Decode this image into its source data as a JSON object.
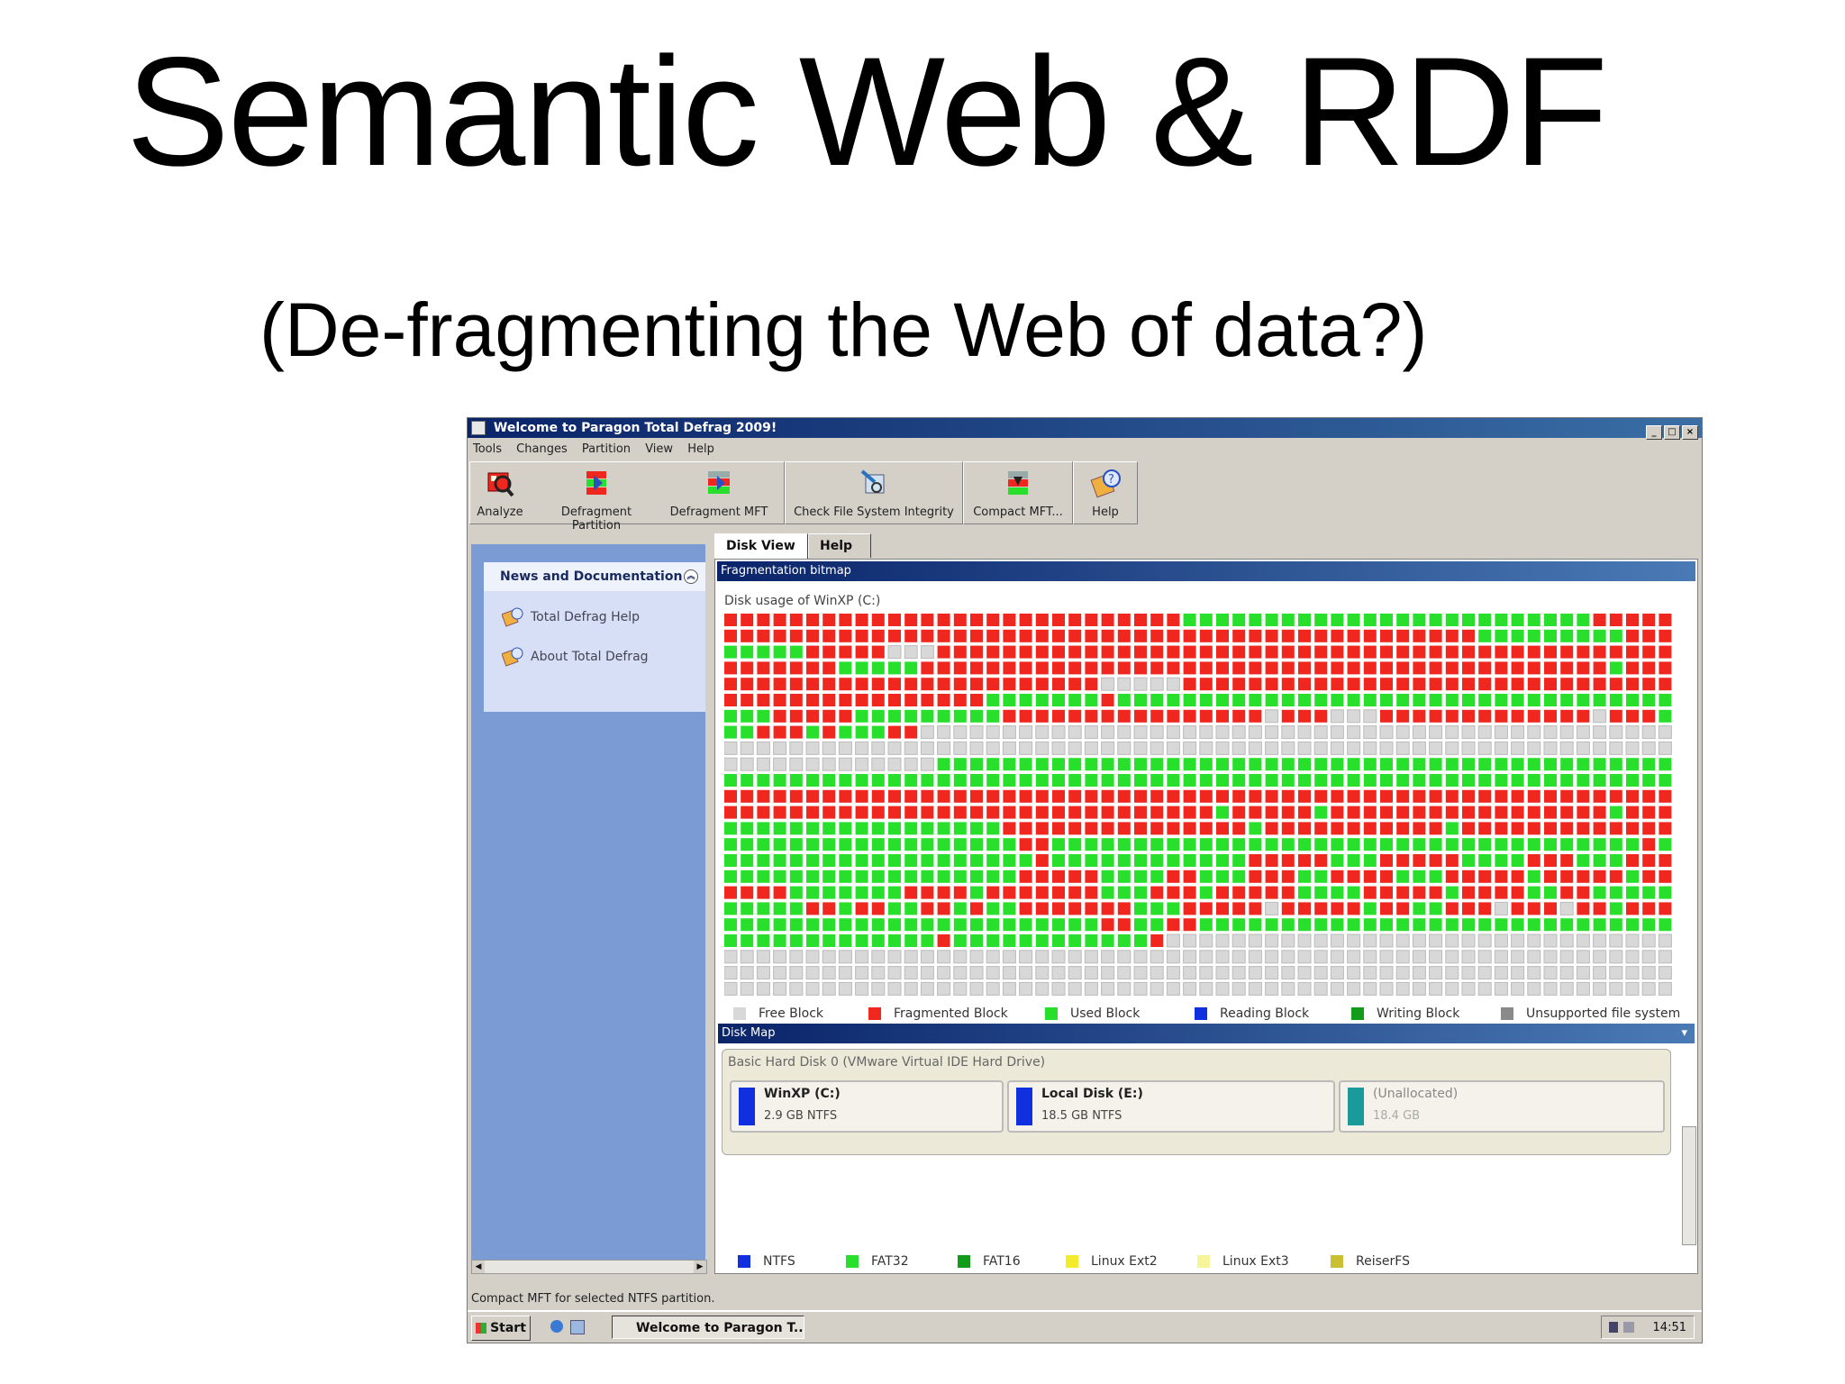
{
  "slide": {
    "title": "Semantic Web & RDF",
    "subtitle": "(De-fragmenting the Web of data?)"
  },
  "window": {
    "title": "Welcome to Paragon Total Defrag 2009!",
    "menu": [
      "Tools",
      "Changes",
      "Partition",
      "View",
      "Help"
    ],
    "toolbar": {
      "analyze": "Analyze",
      "defrag_partition": "Defragment Partition",
      "defrag_mft": "Defragment MFT",
      "check_fs": "Check File System Integrity",
      "compact_mft": "Compact MFT...",
      "help": "Help"
    },
    "sidebar": {
      "heading": "News and Documentation",
      "items": [
        "Total Defrag Help",
        "About Total Defrag"
      ]
    },
    "tabs": [
      "Disk View",
      "Help"
    ],
    "frag_section": {
      "title": "Fragmentation bitmap",
      "disk_usage": "Disk usage of WinXP (C:)"
    },
    "block_legend": [
      "Free Block",
      "Fragmented Block",
      "Used Block",
      "Reading Block",
      "Writing Block",
      "Unsupported file system"
    ],
    "diskmap": {
      "title": "Disk Map",
      "disk_label": "Basic Hard Disk 0 (VMware Virtual IDE Hard Drive)",
      "partitions": [
        {
          "name": "WinXP (C:)",
          "info": "2.9 GB NTFS"
        },
        {
          "name": "Local Disk (E:)",
          "info": "18.5 GB NTFS"
        },
        {
          "name": "(Unallocated)",
          "info": "18.4 GB"
        }
      ]
    },
    "fs_legend": [
      "NTFS",
      "FAT32",
      "FAT16",
      "Linux Ext2",
      "Linux Ext3",
      "ReiserFS"
    ],
    "status": "Compact MFT for selected NTFS partition.",
    "taskbar": {
      "start": "Start",
      "task": "Welcome to Paragon T...",
      "clock": "14:51"
    }
  },
  "colors": {
    "free": "#d8d8d8",
    "fragmented": "#f0271f",
    "used": "#28e02c",
    "reading": "#1030e0",
    "writing": "#129c1a",
    "unsupported": "#8a8a8a",
    "ntfs": "#1030e0",
    "fat32": "#28e02c",
    "fat16": "#129c1a",
    "ext2": "#f4ec2a",
    "ext3": "#f8f49a",
    "reiserfs": "#c8c030",
    "unallocated": "#1a9a9a"
  },
  "bitmap": {
    "rows": [
      "FFFFFFFFFFFFFFFFFFFFFFFFFFFFUUUUUUUUUUUUUUUUUUUUUUUUUFFFFF",
      "FFFFFFFFFFFFFFFFFFFFFFFFFFFFFFFFFFFFFFFFFFFFFFUUUUUUUUUFFF",
      "UUUUUFFFFFEEEFFFFFFFFFFFFFFFFFFFFFFFFFFFFFFFFFFFFFFFFFFFFF",
      "FFFFFFFUUUUUFFFFFFFFFFFFFFFFFFFFFFFFFFFFFFFFFFFFFFFFFFUFFF",
      "FFFFFFFFFFFFFFFFFFFFFFFEEEEEFFFFFFFFFFFFFFFFFFFFFFFFFFFFFF",
      "FFFFFFFFFFFFFFFFUUUUUUUFUUUUUUUUUUUUUUUUUUUUUUUUUUUUUUUUUU",
      "UUUFFFFFUUUUUUUUUFFFFFFFFFFFFFFFFEFFFEEEFFFFFFFFFFFFFEFFFU",
      "UUFFFUFUUUFFEEEEEEEEEEEEEEEEEEEEEEEEEEEEEEEEEEEEEEEEEEEEEE",
      "EEEEEEEEEEEEEEEEEEEEEEEEEEEEEEEEEEEEEEEEEEEEEEEEEEEEEEEEEE",
      "EEEEEEEEEEEEEUUUUUUUUUUUUUUUUUUUUUUUUUUUUUUUUUUUUUUUUUUUUU",
      "UUUUUUUUUUUUUUUUUUUUUUUUUUUUUUUUUUUUUUUUUUUUUUUUUUUUUUUUUU",
      "FFFFFFFFFFFFFFFFFFFFFFFFFFFFFFFFFFFFFFFFFFFFFFFFFFFFFFFFFF",
      "FFFFFFFFFFFFFFFFFFFFFFFFFFFFFFUFFFFFUFFFFFFFFFFFFFFFFFUFFF",
      "UUUUUUUUUUUUUUUUUFFFFFFFFFFFFFFFUFFFFFFFFFFFUFFFFFFFFFFFFF",
      "UUUUUUUUUUUUUUUUUUFFUUUUUUUUUUUUUUUUUUUUUUUUUUUUUUUUUUUUFU",
      "UUUUUUUUUUUUUUUUUUUFUUUUUUUUUUUUFFFFFUUUFFFFFUUUUFFFUUUFFF",
      "UUUUUUUUUUUUUUUUUUFFFFFUUUUFFUUUFFFUUFFFFUUUFFFFFUFFFFFUFF",
      "FFFFUUUUUUUFFFFUFFFFFFFUUUFFFUFFFFFUUUUFFFFFUFFFFUUFFUUUUU",
      "UUUUUFFUFFUUFFUFUUFFFFFFFUUUFFFFFEFFFFFUFFUUFFFEFFFEFFUFFF",
      "UUUUUUUUUUUUUUUUUUUUUUUFFUUFFUUUUUUUUUUUUUUUUUUUUUUUUUUUUU",
      "UUUUUUUUUUUUUFUUUUUUUUUUUUFEEEEEEEEEEEEEEEEEEEEEEEEEEEEEEE",
      "EEEEEEEEEEEEEEEEEEEEEEEEEEEEEEEEEEEEEEEEEEEEEEEEEEEEEEEEEE",
      "EEEEEEEEEEEEEEEEEEEEEEEEEEEEEEEEEEEEEEEEEEEEEEEEEEEEEEEEEE",
      "EEEEEEEEEEEEEEEEEEEEEEEEEEEEEEEEEEEEEEEEEEEEEEEEEEEEEEEEEE"
    ]
  }
}
